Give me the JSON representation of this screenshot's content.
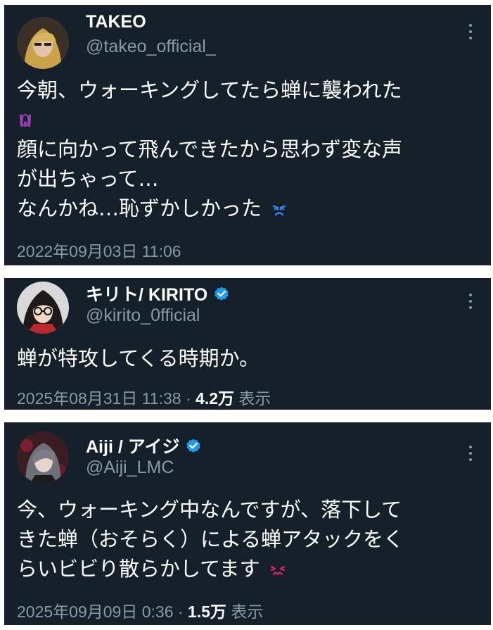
{
  "tweets": [
    {
      "name": "TAKEO",
      "verified": false,
      "handle": "@takeo_official_",
      "lines": [
        "今朝、ウォーキングしてたら蝉に襲われた",
        "",
        "顔に向かって飛んできたから思わず変な声",
        "が出ちゃって…",
        "なんかね…恥ずかしかった"
      ],
      "emojis": [
        "scream-emoji",
        "tired-face-emoji"
      ],
      "timestamp": "2022年09月03日 11:06"
    },
    {
      "name": "キリト/ KIRITO",
      "verified": true,
      "handle": "@kirito_0fficial",
      "lines": [
        "蝉が特攻してくる時期か。"
      ],
      "timestamp": "2025年08月31日 11:38",
      "sep": "·",
      "views": "4.2万",
      "views_label": "表示"
    },
    {
      "name": "Aiji / アイジ",
      "verified": true,
      "handle": "@Aiji_LMC",
      "lines": [
        "今、ウォーキング中なんですが、落下して",
        "きた蝉（おそらく）による蝉アタックをく",
        "らいビビり散らかしてます"
      ],
      "emojis": [
        "confounded-emoji"
      ],
      "timestamp": "2025年09月09日 0:36",
      "sep": "·",
      "views": "1.5万",
      "views_label": "表示"
    }
  ],
  "colors": {
    "card_bg": "#15202b",
    "text": "#ffffff",
    "secondary": "#8b98a5",
    "verified": "#1d9bf0"
  }
}
